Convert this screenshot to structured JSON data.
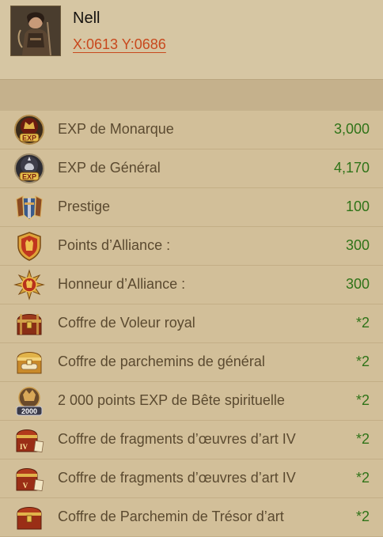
{
  "player": {
    "name": "Nell",
    "coords": "X:0613 Y:0686"
  },
  "rewards": [
    {
      "icon": "monarch-exp-icon",
      "label": "EXP de Monarque",
      "value": "3,000"
    },
    {
      "icon": "general-exp-icon",
      "label": "EXP de Général",
      "value": "4,170"
    },
    {
      "icon": "prestige-icon",
      "label": "Prestige",
      "value": "100"
    },
    {
      "icon": "alliance-points-icon",
      "label": "Points d’Alliance :",
      "value": "300"
    },
    {
      "icon": "alliance-honor-icon",
      "label": "Honneur d’Alliance :",
      "value": "300"
    },
    {
      "icon": "royal-thief-chest-icon",
      "label": "Coffre de Voleur royal",
      "value": "*2"
    },
    {
      "icon": "general-scroll-chest-icon",
      "label": "Coffre de parchemins de général",
      "value": "*2"
    },
    {
      "icon": "beast-exp-icon",
      "label": "2 000 points EXP de Bête spirituelle",
      "value": "*2"
    },
    {
      "icon": "artwork-fragment-chest-iv-icon",
      "label": "Coffre de fragments d’œuvres d’art IV",
      "value": "*2"
    },
    {
      "icon": "artwork-fragment-chest-v-icon",
      "label": "Coffre de fragments d’œuvres d’art IV",
      "value": "*2"
    },
    {
      "icon": "art-treasure-scroll-chest-icon",
      "label": "Coffre de Parchemin de Trésor d’art",
      "value": "*2"
    }
  ],
  "icon_text": {
    "exp_badge": "EXP",
    "beast_amount": "2000",
    "roman_iv": "IV",
    "roman_v": "V"
  }
}
